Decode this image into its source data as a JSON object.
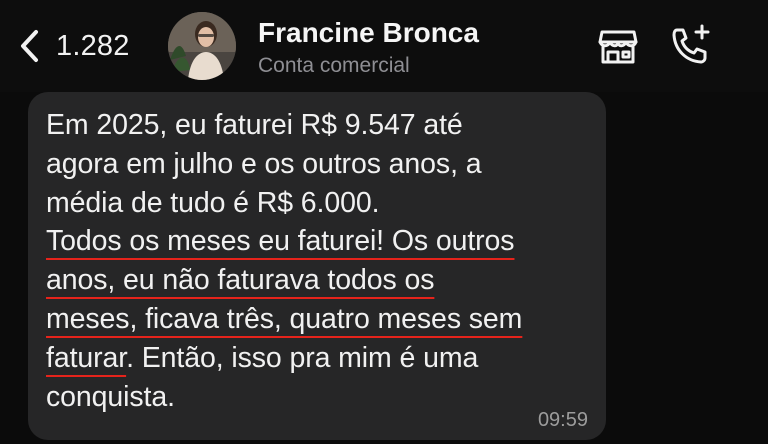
{
  "header": {
    "back_count": "1.282",
    "contact_name": "Francine Bronca",
    "contact_subtitle": "Conta comercial",
    "icons": {
      "back": "chevron-left-icon",
      "store": "storefront-icon",
      "call": "phone-add-icon"
    }
  },
  "message": {
    "lines": [
      {
        "text": "Em 2025, eu faturei R$ 9.547 até"
      },
      {
        "text": "agora em julho e os outros anos, a"
      },
      {
        "text": "média de tudo é R$ 6.000."
      },
      {
        "text": "Todos os meses eu faturei! Os outros"
      },
      {
        "text": "anos, eu não faturava todos os"
      },
      {
        "text": "meses, ficava três, quatro meses sem"
      },
      {
        "pre": "faturar",
        "post": ". Então, isso pra mim é uma"
      },
      {
        "text": "conquista."
      }
    ],
    "time": "09:59"
  },
  "colors": {
    "background": "#0b0b0b",
    "bubble": "#262627",
    "underline": "#e5231b",
    "subtitle": "#8e8e93"
  }
}
